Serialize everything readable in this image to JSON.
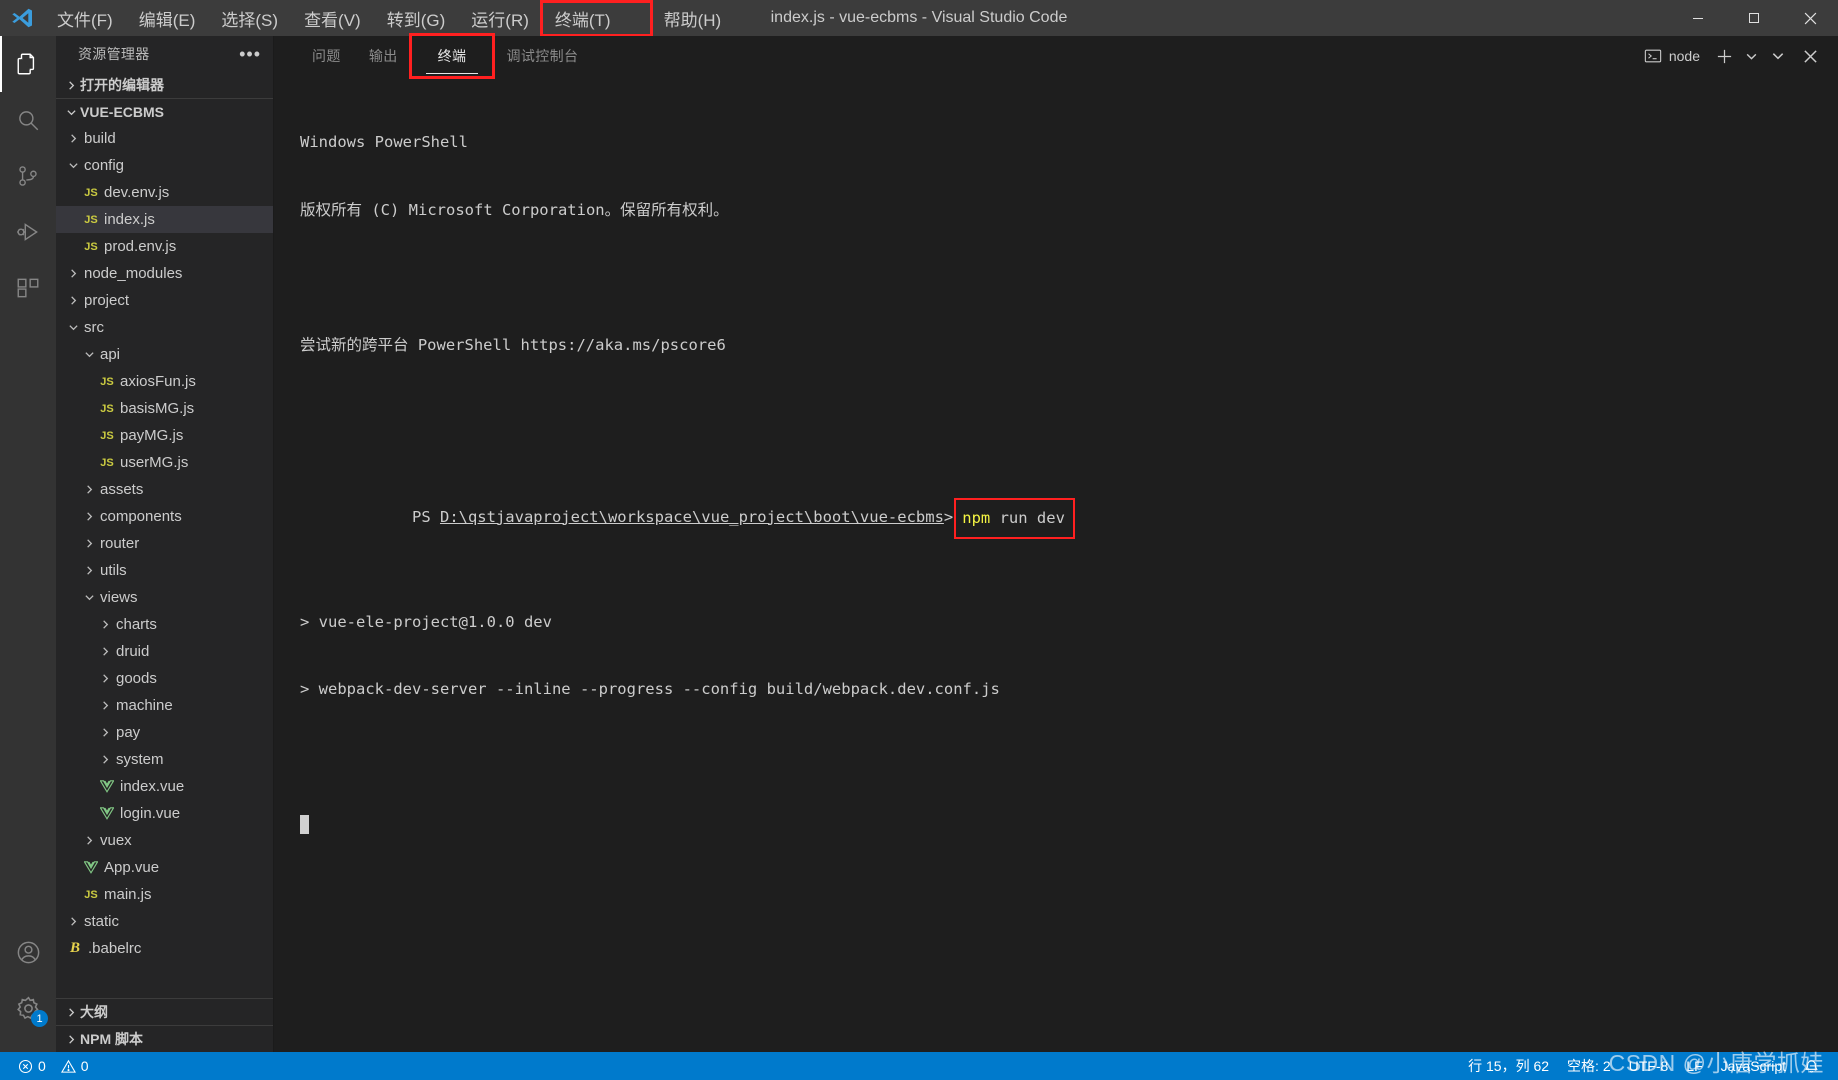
{
  "window": {
    "title": "index.js - vue-ecbms - Visual Studio Code",
    "minimize_label": "─",
    "maximize_label": "□",
    "close_label": "✕"
  },
  "menubar": {
    "items": [
      {
        "label": "文件(F)",
        "name": "menu-file",
        "boxed": false
      },
      {
        "label": "编辑(E)",
        "name": "menu-edit",
        "boxed": false
      },
      {
        "label": "选择(S)",
        "name": "menu-selection",
        "boxed": false
      },
      {
        "label": "查看(V)",
        "name": "menu-view",
        "boxed": false
      },
      {
        "label": "转到(G)",
        "name": "menu-go",
        "boxed": false
      },
      {
        "label": "运行(R)",
        "name": "menu-run",
        "boxed": false
      },
      {
        "label": "终端(T)",
        "name": "menu-terminal",
        "boxed": true
      },
      {
        "label": "帮助(H)",
        "name": "menu-help",
        "boxed": false
      }
    ]
  },
  "activitybar": {
    "items": [
      {
        "name": "explorer-icon",
        "active": true
      },
      {
        "name": "search-icon",
        "active": false
      },
      {
        "name": "source-control-icon",
        "active": false
      },
      {
        "name": "run-and-debug-icon",
        "active": false
      },
      {
        "name": "extensions-icon",
        "active": false
      }
    ],
    "account_icon": "account-icon",
    "settings_icon": "gear-icon",
    "settings_badge": "1"
  },
  "sidebar": {
    "title": "资源管理器",
    "more_actions": "•••",
    "open_editors_label": "打开的编辑器",
    "project_label": "VUE-ECBMS",
    "outline_label": "大纲",
    "npm_scripts_label": "NPM 脚本",
    "tree": [
      {
        "label": "build",
        "type": "folder",
        "open": false,
        "depth": 1,
        "selected": false
      },
      {
        "label": "config",
        "type": "folder",
        "open": true,
        "depth": 1,
        "selected": false
      },
      {
        "label": "dev.env.js",
        "type": "js",
        "depth": 2,
        "selected": false
      },
      {
        "label": "index.js",
        "type": "js",
        "depth": 2,
        "selected": true
      },
      {
        "label": "prod.env.js",
        "type": "js",
        "depth": 2,
        "selected": false
      },
      {
        "label": "node_modules",
        "type": "folder",
        "open": false,
        "depth": 1,
        "selected": false
      },
      {
        "label": "project",
        "type": "folder",
        "open": false,
        "depth": 1,
        "selected": false
      },
      {
        "label": "src",
        "type": "folder",
        "open": true,
        "depth": 1,
        "selected": false
      },
      {
        "label": "api",
        "type": "folder",
        "open": true,
        "depth": 2,
        "selected": false
      },
      {
        "label": "axiosFun.js",
        "type": "js",
        "depth": 3,
        "selected": false
      },
      {
        "label": "basisMG.js",
        "type": "js",
        "depth": 3,
        "selected": false
      },
      {
        "label": "payMG.js",
        "type": "js",
        "depth": 3,
        "selected": false
      },
      {
        "label": "userMG.js",
        "type": "js",
        "depth": 3,
        "selected": false
      },
      {
        "label": "assets",
        "type": "folder",
        "open": false,
        "depth": 2,
        "selected": false
      },
      {
        "label": "components",
        "type": "folder",
        "open": false,
        "depth": 2,
        "selected": false
      },
      {
        "label": "router",
        "type": "folder",
        "open": false,
        "depth": 2,
        "selected": false
      },
      {
        "label": "utils",
        "type": "folder",
        "open": false,
        "depth": 2,
        "selected": false
      },
      {
        "label": "views",
        "type": "folder",
        "open": true,
        "depth": 2,
        "selected": false
      },
      {
        "label": "charts",
        "type": "folder",
        "open": false,
        "depth": 3,
        "selected": false
      },
      {
        "label": "druid",
        "type": "folder",
        "open": false,
        "depth": 3,
        "selected": false
      },
      {
        "label": "goods",
        "type": "folder",
        "open": false,
        "depth": 3,
        "selected": false
      },
      {
        "label": "machine",
        "type": "folder",
        "open": false,
        "depth": 3,
        "selected": false
      },
      {
        "label": "pay",
        "type": "folder",
        "open": false,
        "depth": 3,
        "selected": false
      },
      {
        "label": "system",
        "type": "folder",
        "open": false,
        "depth": 3,
        "selected": false
      },
      {
        "label": "index.vue",
        "type": "vue",
        "depth": 3,
        "selected": false
      },
      {
        "label": "login.vue",
        "type": "vue",
        "depth": 3,
        "selected": false
      },
      {
        "label": "vuex",
        "type": "folder",
        "open": false,
        "depth": 2,
        "selected": false
      },
      {
        "label": "App.vue",
        "type": "vue",
        "depth": 2,
        "selected": false
      },
      {
        "label": "main.js",
        "type": "js",
        "depth": 2,
        "selected": false
      },
      {
        "label": "static",
        "type": "folder",
        "open": false,
        "depth": 1,
        "selected": false
      },
      {
        "label": ".babelrc",
        "type": "babel",
        "depth": 1,
        "selected": false
      }
    ]
  },
  "panel": {
    "tabs": [
      {
        "label": "问题",
        "name": "tab-problems",
        "active": false,
        "boxed": false
      },
      {
        "label": "输出",
        "name": "tab-output",
        "active": false,
        "boxed": false
      },
      {
        "label": "终端",
        "name": "tab-terminal",
        "active": true,
        "boxed": true
      },
      {
        "label": "调试控制台",
        "name": "tab-debug-console",
        "active": false,
        "boxed": false
      }
    ],
    "terminal_selector_label": "node",
    "terminal_selector_icon": "terminal-icon",
    "new_terminal_icon": "plus-icon",
    "new_terminal_dropdown_icon": "chevron-down-icon",
    "panel_maximize_icon": "chevron-down-icon",
    "panel_close_icon": "close-icon"
  },
  "terminal": {
    "line1": "Windows PowerShell",
    "line2": "版权所有 (C) Microsoft Corporation。保留所有权利。",
    "line3": "尝试新的跨平台 PowerShell https://aka.ms/pscore6",
    "prompt_prefix": "PS ",
    "prompt_path": "D:\\qstjavaproject\\workspace\\vue_project\\boot\\vue-ecbms",
    "prompt_suffix": ">",
    "command_keyword": "npm",
    "command_rest": " run dev",
    "out1": "> vue-ele-project@1.0.0 dev",
    "out2": "> webpack-dev-server --inline --progress --config build/webpack.dev.conf.js"
  },
  "statusbar": {
    "errors_icon": "error-circle-icon",
    "errors_count": "0",
    "warnings_icon": "warning-triangle-icon",
    "warnings_count": "0",
    "cursor_position": "行 15，列 62",
    "indentation": "空格: 2",
    "encoding": "UTF-8",
    "eol": "LF",
    "language": "JavaScript",
    "bell_icon": "bell-icon"
  },
  "watermark": {
    "text": "CSDN @小唐学抓娃"
  },
  "colors": {
    "accent": "#007acc",
    "highlight_box": "#ff2020",
    "titlebar_bg": "#3c3c3c",
    "sidebar_bg": "#252526",
    "editor_bg": "#1e1e1e",
    "activitybar_bg": "#333333",
    "terminal_yellow": "#f5f543"
  }
}
